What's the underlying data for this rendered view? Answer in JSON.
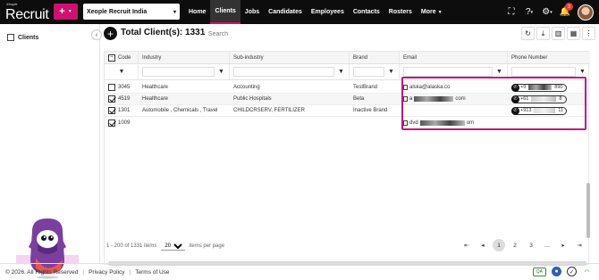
{
  "app": {
    "logo_small": "Xeople",
    "logo_big": "Recruit",
    "company": "Xeople Recruit India",
    "nav": [
      {
        "label": "Home"
      },
      {
        "label": "Clients"
      },
      {
        "label": "Jobs"
      },
      {
        "label": "Candidates"
      },
      {
        "label": "Employees"
      },
      {
        "label": "Contacts"
      },
      {
        "label": "Rosters"
      },
      {
        "label": "More"
      }
    ],
    "notification_count": "3",
    "accent_color": "#d0106e"
  },
  "sidebar": {
    "item_label": "Clients"
  },
  "toolbar": {
    "title": "Total Client(s): 1331",
    "search_placeholder": "Search"
  },
  "grid": {
    "columns": [
      "Code",
      "Industry",
      "Sub-industry",
      "Brand",
      "Email",
      "Phone Number"
    ],
    "rows": [
      {
        "code": "3045",
        "industry": "Healthcare",
        "sub_industry": "Accounting",
        "brand": "TestBrand",
        "email": "alska@alaska.co",
        "email_suffix": "",
        "phone_prefix": "+9",
        "phone_suffix": "890",
        "checked": false
      },
      {
        "code": "4519",
        "industry": "Healthcare",
        "sub_industry": "Public Hospitals",
        "brand": "Beta",
        "email": "a",
        "email_suffix": "com",
        "phone_prefix": "+61",
        "phone_suffix": "8",
        "checked": true
      },
      {
        "code": "1301",
        "industry": "Automobile , Chemicals , Travel",
        "sub_industry": "CHILDCRSERV, FERTILIZER",
        "brand": "Inactive Brand",
        "email": "",
        "email_suffix": "",
        "phone_prefix": "+913",
        "phone_suffix": "11",
        "checked": true
      },
      {
        "code": "1009",
        "industry": "",
        "sub_industry": "",
        "brand": "",
        "email": "dvd",
        "email_suffix": "om",
        "phone_prefix": "",
        "phone_suffix": "",
        "checked": true
      }
    ]
  },
  "pager": {
    "range": "1 - 200 of 1331 items",
    "page_size": "200",
    "per_page_label": "items per page",
    "pages": [
      "1",
      "2",
      "3",
      "…"
    ],
    "current_page": "1"
  },
  "footer": {
    "copyright": "© 2026. All Rights Reserved",
    "privacy": "Privacy Policy",
    "terms": "Terms of Use",
    "env_badge": "QA"
  }
}
